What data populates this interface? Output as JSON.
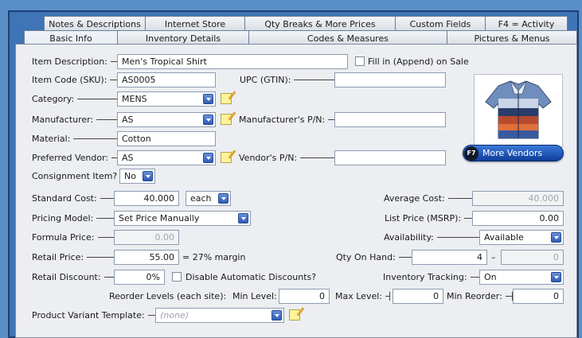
{
  "tabs_row1": [
    {
      "label": "Notes & Descriptions"
    },
    {
      "label": "Internet Store"
    },
    {
      "label": "Qty Breaks & More Prices"
    },
    {
      "label": "Custom Fields"
    },
    {
      "label": "F4 = Activity"
    }
  ],
  "tabs_row2": [
    {
      "label": "Basic Info"
    },
    {
      "label": "Inventory Details"
    },
    {
      "label": "Codes & Measures"
    },
    {
      "label": "Pictures & Menus"
    }
  ],
  "form": {
    "item_description": {
      "label": "Item Description:",
      "value": "Men's Tropical Shirt"
    },
    "fill_in_append": {
      "label": "Fill in (Append) on Sale"
    },
    "item_code": {
      "label": "Item Code (SKU):",
      "value": "AS0005"
    },
    "upc": {
      "label": "UPC (GTIN):",
      "value": ""
    },
    "category": {
      "label": "Category:",
      "value": "MENS"
    },
    "manufacturer": {
      "label": "Manufacturer:",
      "value": "AS"
    },
    "manufacturer_pn": {
      "label": "Manufacturer's P/N:",
      "value": ""
    },
    "material": {
      "label": "Material:",
      "value": "Cotton"
    },
    "preferred_vendor": {
      "label": "Preferred Vendor:",
      "value": "AS"
    },
    "vendor_pn": {
      "label": "Vendor's P/N:",
      "value": ""
    },
    "consignment": {
      "label": "Consignment Item?",
      "value": "No"
    },
    "more_vendors": {
      "key": "F7",
      "label": "More Vendors"
    },
    "standard_cost": {
      "label": "Standard Cost:",
      "value": "40.000",
      "unit": "each"
    },
    "average_cost": {
      "label": "Average Cost:",
      "value": "40.000"
    },
    "pricing_model": {
      "label": "Pricing Model:",
      "value": "Set Price Manually"
    },
    "list_price": {
      "label": "List Price (MSRP):",
      "value": "0.00"
    },
    "formula_price": {
      "label": "Formula Price:",
      "value": "0.00"
    },
    "availability": {
      "label": "Availability:",
      "value": "Available"
    },
    "retail_price": {
      "label": "Retail Price:",
      "value": "55.00",
      "margin": "= 27% margin"
    },
    "qty_on_hand": {
      "label": "Qty On Hand:",
      "value": "4",
      "dash": "–",
      "value2": "0"
    },
    "retail_discount": {
      "label": "Retail Discount:",
      "value": "0%"
    },
    "disable_discounts": {
      "label": "Disable Automatic Discounts?"
    },
    "inventory_tracking": {
      "label": "Inventory Tracking:",
      "value": "On"
    },
    "reorder": {
      "label": "Reorder Levels (each site):",
      "min_level_label": "Min Level:",
      "min_level": "0",
      "max_level_label": "Max Level:",
      "max_level": "0",
      "min_reorder_label": "Min Reorder:",
      "min_reorder": "0"
    },
    "variant_template": {
      "label": "Product Variant Template:",
      "value": "(none)"
    }
  },
  "colors": {
    "accent": "#3f74b6",
    "panel": "#eceef2",
    "button": "#1f56b8"
  }
}
